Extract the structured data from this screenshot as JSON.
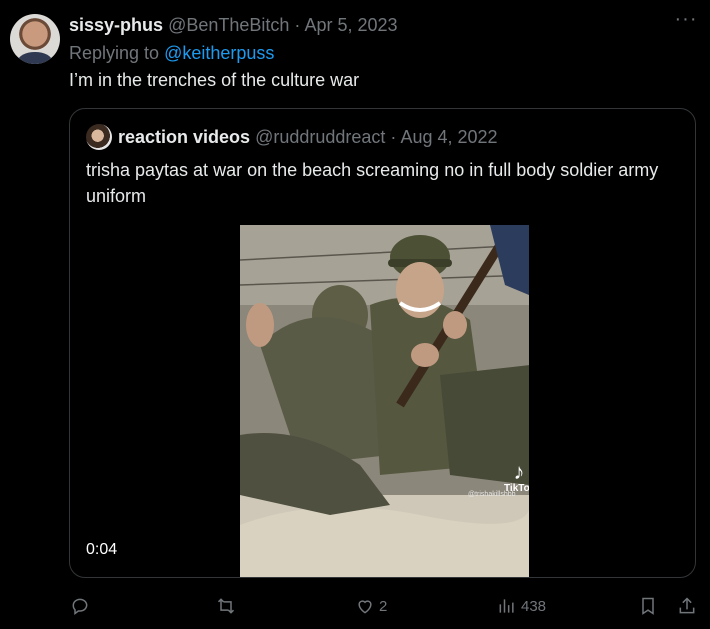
{
  "tweet": {
    "display_name": "sissy-phus",
    "handle": "@BenTheBitch",
    "separator": "·",
    "date": "Apr 5, 2023",
    "replying_to_prefix": "Replying to",
    "replying_to_handle": "@keitherpuss",
    "text": "I’m in the trenches of the culture war",
    "more_icon": "more-icon"
  },
  "quote": {
    "display_name": "reaction videos",
    "handle": "@ruddruddreact",
    "separator": "·",
    "date": "Aug 4, 2022",
    "text": "trisha paytas at war on the beach screaming no in full body soldier army uniform",
    "video_time": "0:04",
    "watermark": "TikTok",
    "watermark_handle": "@trishakillshbb"
  },
  "actions": {
    "reply_count": "",
    "retweet_count": "",
    "like_count": "2",
    "views_count": "438"
  },
  "colors": {
    "background": "#000000",
    "text": "#e7e9ea",
    "muted": "#71767b",
    "link": "#1d9bf0",
    "border": "#333639"
  }
}
